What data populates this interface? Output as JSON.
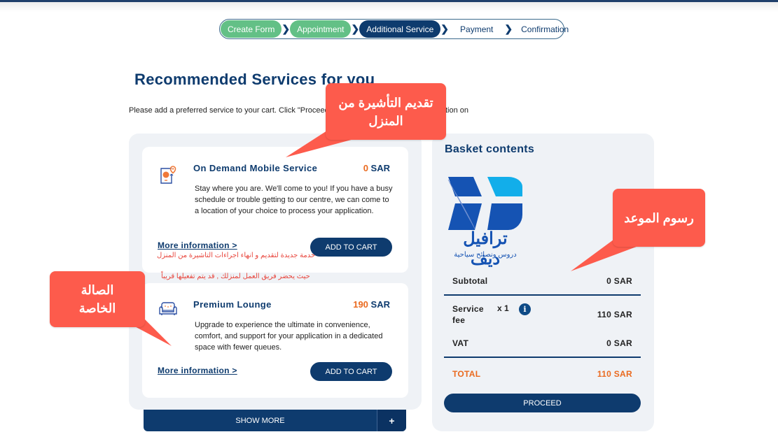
{
  "stepper": {
    "steps": [
      {
        "label": "Create Form",
        "state": "done"
      },
      {
        "label": "Appointment",
        "state": "done"
      },
      {
        "label": "Additional Service",
        "state": "active"
      },
      {
        "label": "Payment",
        "state": "todo"
      },
      {
        "label": "Confirmation",
        "state": "todo"
      }
    ]
  },
  "page": {
    "title": "Recommended Services for you",
    "intro_start": "Please add a preferred service to your cart. Click \"Proceed",
    "intro_end": "tion on"
  },
  "services": [
    {
      "icon": "mobile-service-icon",
      "name": "On Demand Mobile Service",
      "price_value": "0",
      "currency": "SAR",
      "description": "Stay where you are. We'll come to you! If you have a busy schedule or trouble getting to our centre, we can come to a location of your choice to process your application.",
      "more_label": "More information >",
      "add_label": "ADD TO CART",
      "note_line1": "خدمة جديدة لتقديم و انهاء اجراءات التاشيرة من المنزل",
      "note_line2": "حيث يحضر فريق العمل لمنزلك , قد يتم تفعيلها قريباً"
    },
    {
      "icon": "sofa-icon",
      "name": "Premium Lounge",
      "price_value": "190",
      "currency": "SAR",
      "description": "Upgrade to experience the ultimate in convenience, comfort, and support for your application in a dedicated space with fewer queues.",
      "more_label": "More information >",
      "add_label": "ADD TO CART"
    }
  ],
  "show_more": {
    "label": "SHOW MORE",
    "plus": "+"
  },
  "basket": {
    "title": "Basket contents",
    "logo_text": "ترافيل ديف",
    "logo_sub": "دروس ونصائح سياحية",
    "subtotal_label": "Subtotal",
    "subtotal_value": "0 SAR",
    "service_fee_label_1": "Service",
    "service_fee_label_2": "fee",
    "service_fee_qty": "x 1",
    "service_fee_value": "110 SAR",
    "vat_label": "VAT",
    "vat_value": "0 SAR",
    "total_label": "TOTAL",
    "total_value": "110 SAR",
    "proceed_label": "PROCEED",
    "info_glyph": "i"
  },
  "callouts": {
    "home_visa": "تقديم التأشيرة من المنزل",
    "private_lounge": "الصالة الخاصة",
    "appointment_fees": "رسوم الموعد"
  },
  "colors": {
    "primary": "#0e3b6e",
    "done": "#63c086",
    "accent": "#ea6a1f",
    "callout": "#fd5b4c"
  }
}
